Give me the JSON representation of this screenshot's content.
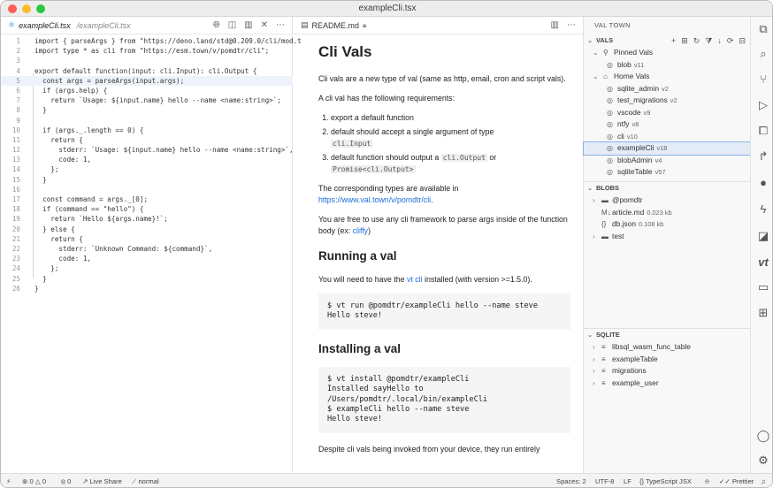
{
  "window_title": "exampleCli.tsx",
  "editor": {
    "tab_name": "exampleCli.tsx",
    "tab_path": "/exampleCli.tsx",
    "lines": [
      {
        "n": "1",
        "t": "import { parseArgs } from \"https://deno.land/std@0.209.0/cli/mod.t"
      },
      {
        "n": "2",
        "t": "import type * as cli from \"https://esm.town/v/pomdtr/cli\";"
      },
      {
        "n": "3",
        "t": ""
      },
      {
        "n": "4",
        "t": "export default function(input: cli.Input): cli.Output {"
      },
      {
        "n": "5",
        "t": "  const args = parseArgs(input.args);"
      },
      {
        "n": "6",
        "t": "  if (args.help) {"
      },
      {
        "n": "7",
        "t": "    return `Usage: ${input.name} hello --name <name:string>`;"
      },
      {
        "n": "8",
        "t": "  }"
      },
      {
        "n": "9",
        "t": ""
      },
      {
        "n": "10",
        "t": "  if (args._.length == 0) {"
      },
      {
        "n": "11",
        "t": "    return {"
      },
      {
        "n": "12",
        "t": "      stderr: `Usage: ${input.name} hello --name <name:string>`,"
      },
      {
        "n": "13",
        "t": "      code: 1,"
      },
      {
        "n": "14",
        "t": "    };"
      },
      {
        "n": "15",
        "t": "  }"
      },
      {
        "n": "16",
        "t": ""
      },
      {
        "n": "17",
        "t": "  const command = args._[0];"
      },
      {
        "n": "18",
        "t": "  if (command == \"hello\") {"
      },
      {
        "n": "19",
        "t": "    return `Hello ${args.name}!`;"
      },
      {
        "n": "20",
        "t": "  } else {"
      },
      {
        "n": "21",
        "t": "    return {"
      },
      {
        "n": "22",
        "t": "      stderr: `Unknown Command: ${command}`,"
      },
      {
        "n": "23",
        "t": "      code: 1,"
      },
      {
        "n": "24",
        "t": "    };"
      },
      {
        "n": "25",
        "t": "  }"
      },
      {
        "n": "26",
        "t": "}"
      }
    ]
  },
  "preview": {
    "tab_name": "README.md",
    "h1": "Cli Vals",
    "p1": "Cli vals are a new type of val (same as http, email, cron and script vals).",
    "p2": "A cli val has the following requirements:",
    "req1": "export a default function",
    "req2a": "default should accept a single argument of type",
    "req2b": "cli.Input",
    "req3a": "default function should output a",
    "req3b": "cli.Output",
    "req3c": "or",
    "req3d": "Promise<cli.Output>",
    "p3a": "The corresponding types are available in",
    "p3b": "https://www.val.town/v/pomdtr/cli",
    "p3c": ".",
    "p4a": "You are free to use any cli framework to parse args inside of the function body (ex:",
    "p4b": "cliffy",
    "p4c": ")",
    "h2a": "Running a val",
    "p5a": "You will need to have the",
    "p5b": "vt cli",
    "p5c": "installed (with version >=1.5.0).",
    "code1": "$ vt run @pomdtr/exampleCli hello --name steve\nHello steve!",
    "h2b": "Installing a val",
    "code2": "$ vt install @pomdtr/exampleCli\nInstalled sayHello to\n/Users/pomdtr/.local/bin/exampleCli\n$ exampleCli hello --name steve\nHello steve!",
    "p6": "Despite cli vals being invoked from your device, they run entirely"
  },
  "sidebar": {
    "header": "VAL TOWN",
    "vals_label": "VALS",
    "pinned_label": "Pinned Vals",
    "pinned": [
      {
        "name": "blob",
        "ver": "v11"
      }
    ],
    "home_label": "Home Vals",
    "home": [
      {
        "name": "sqlite_admin",
        "ver": "v2"
      },
      {
        "name": "test_migrations",
        "ver": "v2"
      },
      {
        "name": "vscode",
        "ver": "v9"
      },
      {
        "name": "ntfy",
        "ver": "v8"
      },
      {
        "name": "cli",
        "ver": "v10"
      },
      {
        "name": "exampleCli",
        "ver": "v18"
      },
      {
        "name": "blobAdmin",
        "ver": "v4"
      },
      {
        "name": "sqliteTable",
        "ver": "v57"
      }
    ],
    "blobs_label": "BLOBS",
    "blobs": [
      {
        "name": "@pomdtr",
        "meta": "",
        "kind": "folder"
      },
      {
        "name": "article.md",
        "meta": "0.023 kb",
        "kind": "md"
      },
      {
        "name": "db.json",
        "meta": "0.108 kb",
        "kind": "json"
      },
      {
        "name": "test",
        "meta": "",
        "kind": "folder"
      }
    ],
    "sqlite_label": "SQLITE",
    "tables": [
      "libsql_wasm_func_table",
      "exampleTable",
      "migrations",
      "example_user"
    ]
  },
  "status": {
    "errors": "0",
    "warnings": "0",
    "ports": "0",
    "live_share": "Live Share",
    "mode": "normal",
    "spaces": "Spaces: 2",
    "encoding": "UTF-8",
    "eol": "LF",
    "language": "TypeScript JSX",
    "prettier": "Prettier"
  }
}
